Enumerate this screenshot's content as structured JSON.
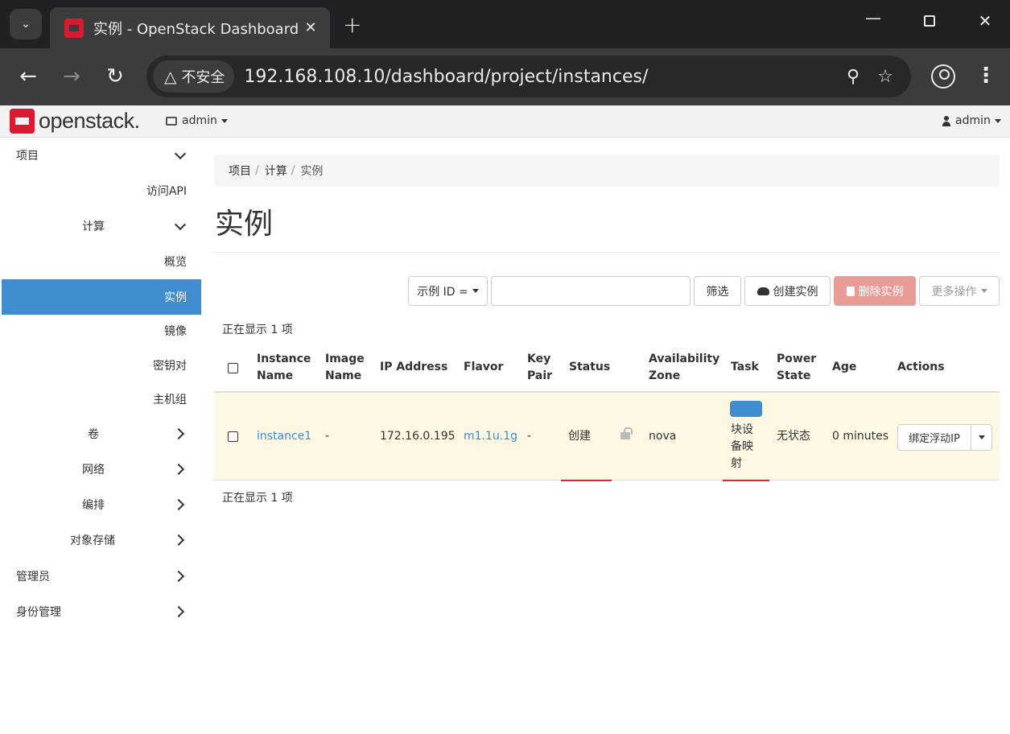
{
  "browser": {
    "tab_title": "实例 - OpenStack Dashboard",
    "security_label": "不安全",
    "url": "192.168.108.10/dashboard/project/instances/"
  },
  "navbar": {
    "brand": "openstack.",
    "project": "admin",
    "user": "admin"
  },
  "sidebar": {
    "items": [
      {
        "label": "项目",
        "icon": "chevron-down-icon"
      },
      {
        "label": "访问API"
      },
      {
        "label": "计算",
        "icon": "chevron-down-icon"
      },
      {
        "label": "概览"
      },
      {
        "label": "实例",
        "active": true
      },
      {
        "label": "镜像"
      },
      {
        "label": "密钥对"
      },
      {
        "label": "主机组"
      },
      {
        "label": "卷",
        "icon": "chevron-right-icon"
      },
      {
        "label": "网络",
        "icon": "chevron-right-icon"
      },
      {
        "label": "编排",
        "icon": "chevron-right-icon"
      },
      {
        "label": "对象存储",
        "icon": "chevron-right-icon"
      },
      {
        "label": "管理员",
        "icon": "chevron-right-icon"
      },
      {
        "label": "身份管理",
        "icon": "chevron-right-icon"
      }
    ]
  },
  "breadcrumb": [
    "项目",
    "计算",
    "实例"
  ],
  "page_title": "实例",
  "toolbar": {
    "filter_field": "示例 ID =",
    "filter_value": "",
    "filter_button": "筛选",
    "create_button": "创建实例",
    "delete_button": "删除实例",
    "more_button": "更多操作"
  },
  "count_text": "正在显示 1 项",
  "table": {
    "headers": {
      "name": [
        "Instance",
        "Name"
      ],
      "image": [
        "Image",
        "Name"
      ],
      "ip": "IP Address",
      "flavor": "Flavor",
      "keypair": [
        "Key",
        "Pair"
      ],
      "status": "Status",
      "az": [
        "Availability",
        "Zone"
      ],
      "task": "Task",
      "power": [
        "Power",
        "State"
      ],
      "age": "Age",
      "actions": "Actions"
    },
    "rows": [
      {
        "name": "instance1",
        "image": "-",
        "ip": "172.16.0.195",
        "flavor": "m1.1u.1g",
        "keypair": "-",
        "status": "创建",
        "az": "nova",
        "task": [
          "块设",
          "备映",
          "射"
        ],
        "power": "无状态",
        "age": "0 minutes",
        "action": "绑定浮动IP"
      }
    ]
  },
  "colors": {
    "accent": "#3f8ccf",
    "row_highlight": "#fcf8e3",
    "danger_disabled": "#e99b96",
    "brand_red": "#da1a32"
  }
}
